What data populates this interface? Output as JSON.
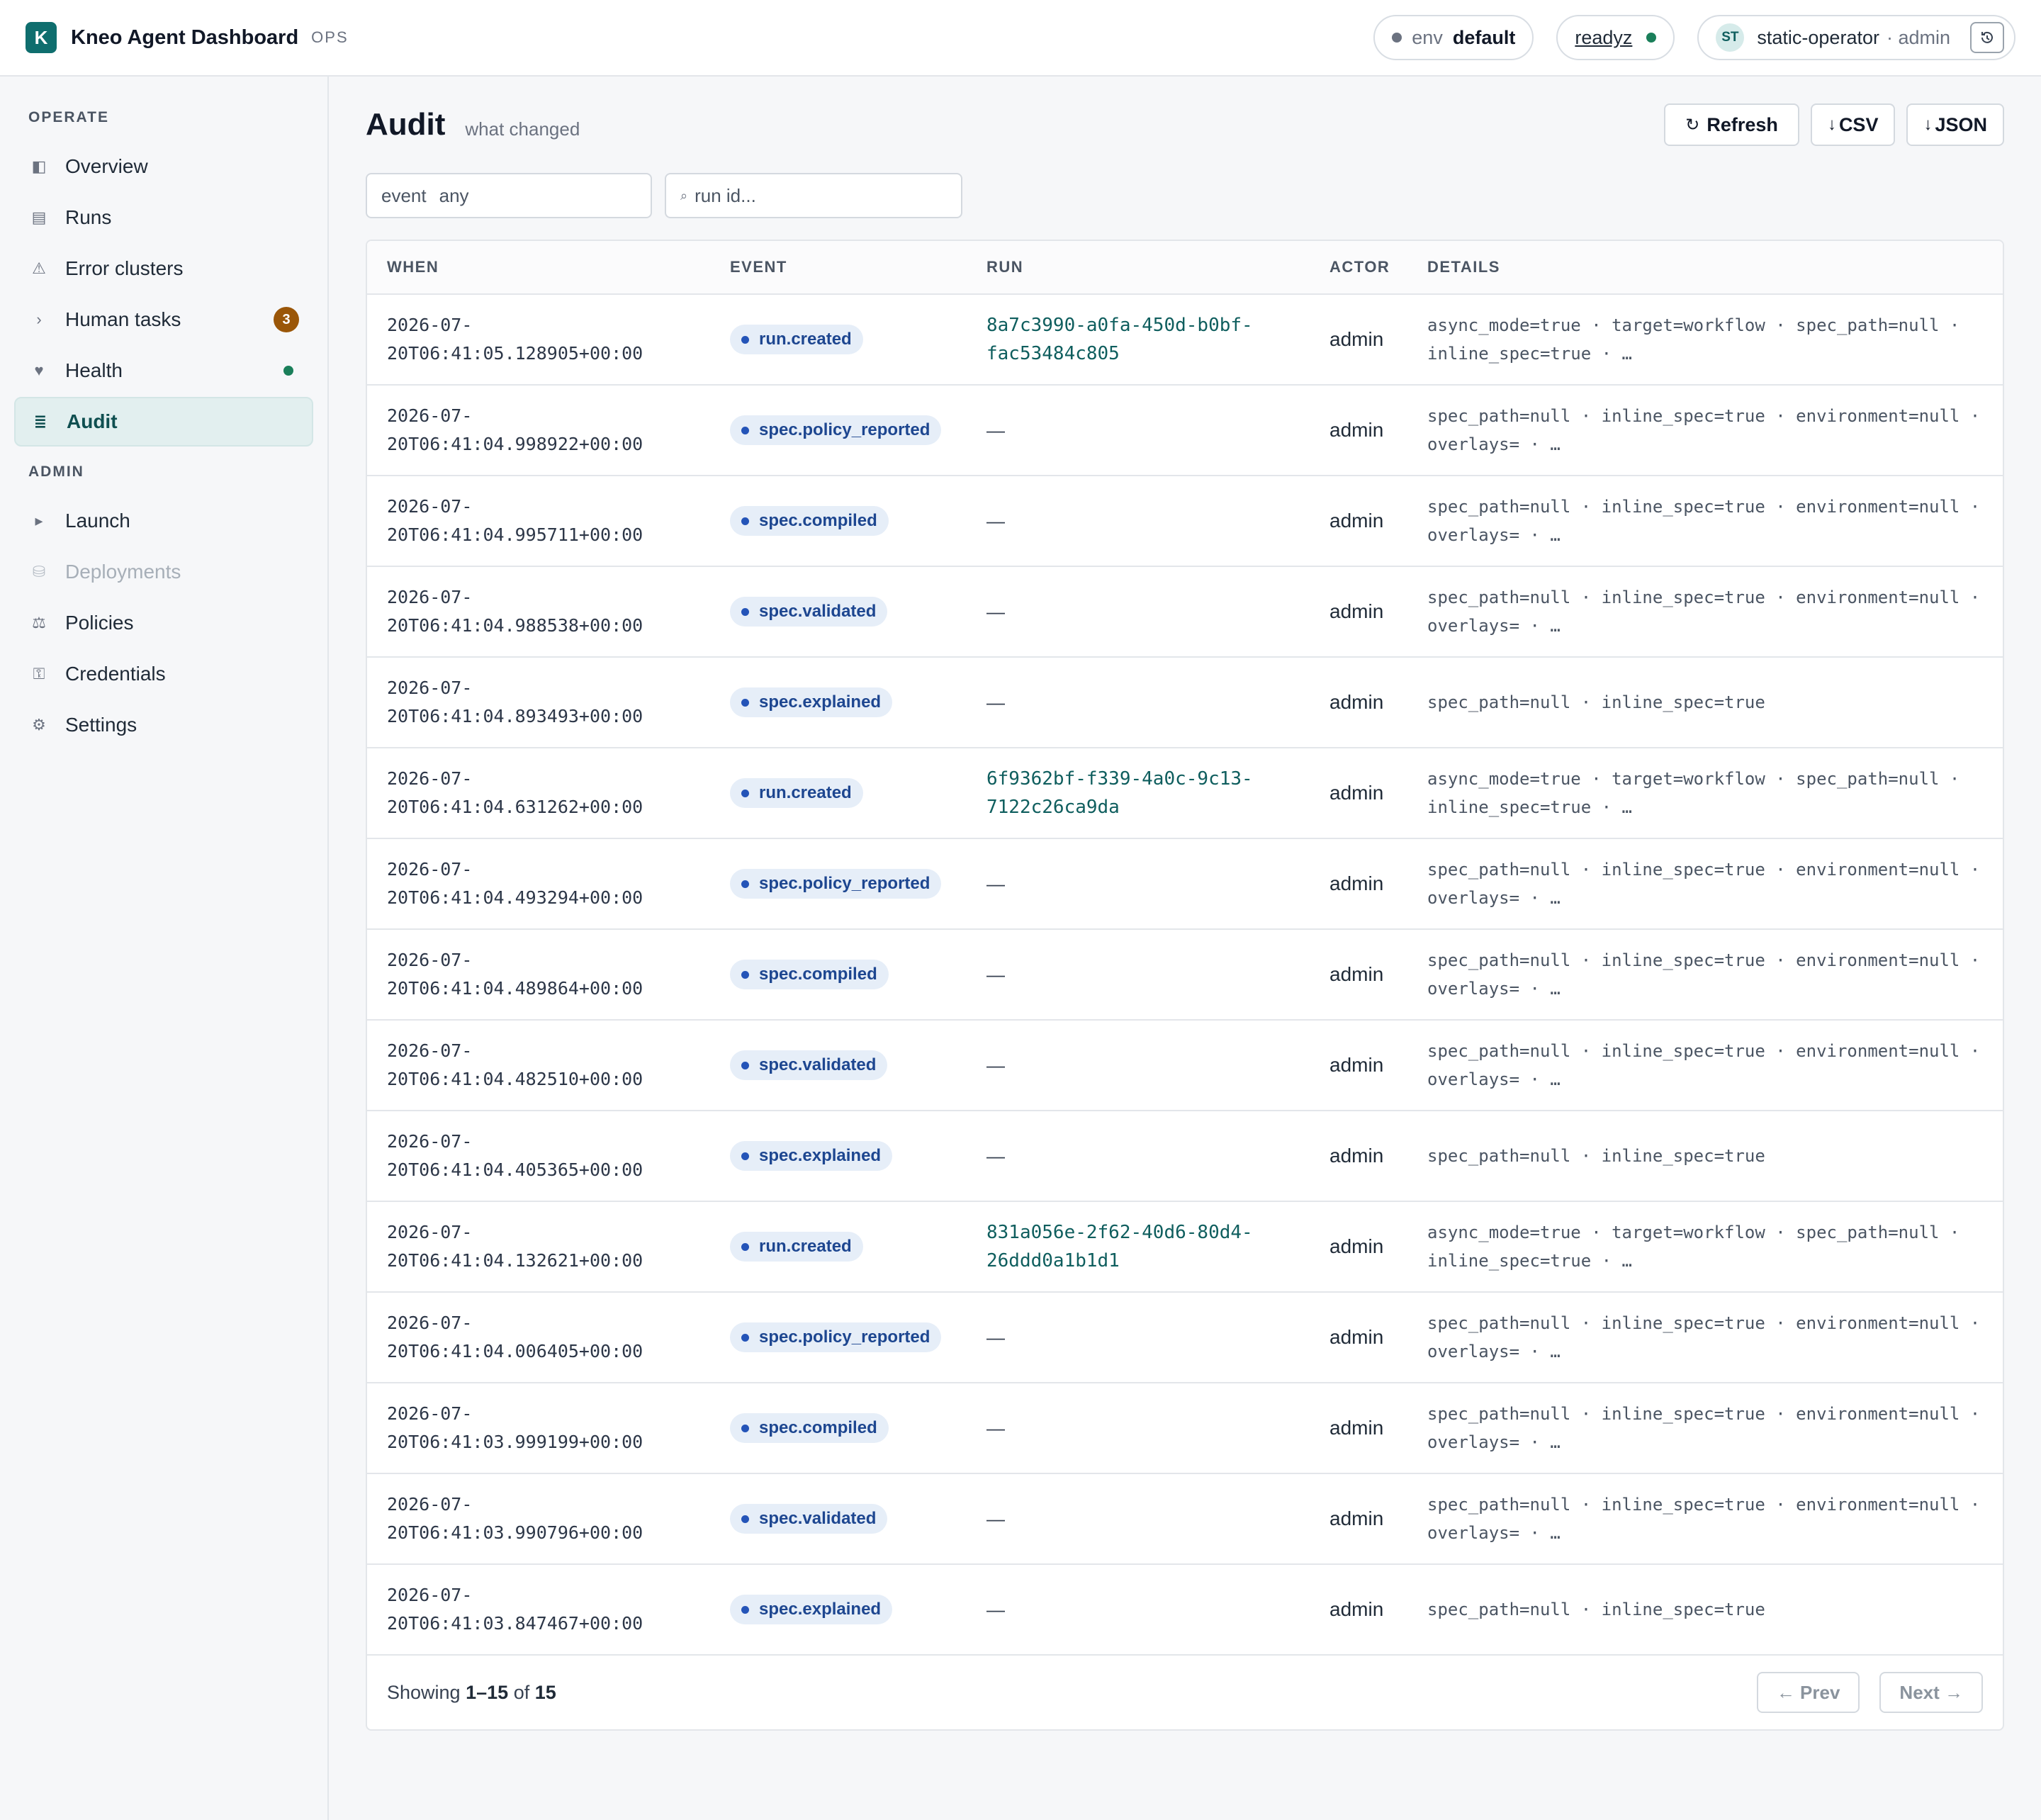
{
  "header": {
    "logo_letter": "K",
    "app_title": "Kneo Agent Dashboard",
    "app_tag": "OPS",
    "env_label": "env",
    "env_value": "default",
    "readyz_label": "readyz",
    "avatar_initials": "ST",
    "user_name": "static-operator",
    "user_role": "· admin"
  },
  "sidebar": {
    "sections": [
      {
        "title": "OPERATE",
        "items": [
          {
            "icon": "◧",
            "icon_name": "overview-icon",
            "label": "Overview"
          },
          {
            "icon": "▤",
            "icon_name": "runs-icon",
            "label": "Runs"
          },
          {
            "icon": "⚠",
            "icon_name": "warning-icon",
            "label": "Error clusters"
          },
          {
            "icon": "›",
            "icon_name": "chevron-right-icon",
            "label": "Human tasks",
            "badge": "3"
          },
          {
            "icon": "♥",
            "icon_name": "heart-icon",
            "label": "Health",
            "status_dot": "green"
          },
          {
            "icon": "≣",
            "icon_name": "audit-icon",
            "label": "Audit",
            "active": true
          }
        ]
      },
      {
        "title": "ADMIN",
        "items": [
          {
            "icon": "▸",
            "icon_name": "play-icon",
            "label": "Launch"
          },
          {
            "icon": "⛁",
            "icon_name": "database-icon",
            "label": "Deployments",
            "disabled": true
          },
          {
            "icon": "⚖",
            "icon_name": "scales-icon",
            "label": "Policies"
          },
          {
            "icon": "⚿",
            "icon_name": "key-icon",
            "label": "Credentials"
          },
          {
            "icon": "⚙",
            "icon_name": "gear-icon",
            "label": "Settings"
          }
        ]
      }
    ]
  },
  "page": {
    "title": "Audit",
    "subtitle": "what changed",
    "actions": {
      "refresh_icon": "↻",
      "refresh_label": "Refresh",
      "csv_icon": "↓",
      "csv_label": "CSV",
      "json_icon": "↓",
      "json_label": "JSON"
    },
    "filters": {
      "event_label": "event",
      "event_value": "any",
      "run_search_icon": "⌕",
      "run_placeholder": "run id..."
    }
  },
  "table": {
    "columns": [
      "WHEN",
      "EVENT",
      "RUN",
      "ACTOR",
      "DETAILS"
    ],
    "rows": [
      {
        "when": "2026-07-\n20T06:41:05.128905+00:00",
        "event": "run.created",
        "run": "8a7c3990-a0fa-450d-b0bf-\nfac53484c805",
        "actor": "admin",
        "details": "async_mode=true · target=workflow · spec_path=null · inline_spec=true · …"
      },
      {
        "when": "2026-07-\n20T06:41:04.998922+00:00",
        "event": "spec.policy_reported",
        "run": "—",
        "actor": "admin",
        "details": "spec_path=null · inline_spec=true · environment=null · overlays= · …"
      },
      {
        "when": "2026-07-\n20T06:41:04.995711+00:00",
        "event": "spec.compiled",
        "run": "—",
        "actor": "admin",
        "details": "spec_path=null · inline_spec=true · environment=null · overlays= · …"
      },
      {
        "when": "2026-07-\n20T06:41:04.988538+00:00",
        "event": "spec.validated",
        "run": "—",
        "actor": "admin",
        "details": "spec_path=null · inline_spec=true · environment=null · overlays= · …"
      },
      {
        "when": "2026-07-\n20T06:41:04.893493+00:00",
        "event": "spec.explained",
        "run": "—",
        "actor": "admin",
        "details": "spec_path=null · inline_spec=true"
      },
      {
        "when": "2026-07-\n20T06:41:04.631262+00:00",
        "event": "run.created",
        "run": "6f9362bf-f339-4a0c-9c13-\n7122c26ca9da",
        "actor": "admin",
        "details": "async_mode=true · target=workflow · spec_path=null · inline_spec=true · …"
      },
      {
        "when": "2026-07-\n20T06:41:04.493294+00:00",
        "event": "spec.policy_reported",
        "run": "—",
        "actor": "admin",
        "details": "spec_path=null · inline_spec=true · environment=null · overlays= · …"
      },
      {
        "when": "2026-07-\n20T06:41:04.489864+00:00",
        "event": "spec.compiled",
        "run": "—",
        "actor": "admin",
        "details": "spec_path=null · inline_spec=true · environment=null · overlays= · …"
      },
      {
        "when": "2026-07-\n20T06:41:04.482510+00:00",
        "event": "spec.validated",
        "run": "—",
        "actor": "admin",
        "details": "spec_path=null · inline_spec=true · environment=null · overlays= · …"
      },
      {
        "when": "2026-07-\n20T06:41:04.405365+00:00",
        "event": "spec.explained",
        "run": "—",
        "actor": "admin",
        "details": "spec_path=null · inline_spec=true"
      },
      {
        "when": "2026-07-\n20T06:41:04.132621+00:00",
        "event": "run.created",
        "run": "831a056e-2f62-40d6-80d4-\n26ddd0a1b1d1",
        "actor": "admin",
        "details": "async_mode=true · target=workflow · spec_path=null · inline_spec=true · …"
      },
      {
        "when": "2026-07-\n20T06:41:04.006405+00:00",
        "event": "spec.policy_reported",
        "run": "—",
        "actor": "admin",
        "details": "spec_path=null · inline_spec=true · environment=null · overlays= · …"
      },
      {
        "when": "2026-07-\n20T06:41:03.999199+00:00",
        "event": "spec.compiled",
        "run": "—",
        "actor": "admin",
        "details": "spec_path=null · inline_spec=true · environment=null · overlays= · …"
      },
      {
        "when": "2026-07-\n20T06:41:03.990796+00:00",
        "event": "spec.validated",
        "run": "—",
        "actor": "admin",
        "details": "spec_path=null · inline_spec=true · environment=null · overlays= · …"
      },
      {
        "when": "2026-07-\n20T06:41:03.847467+00:00",
        "event": "spec.explained",
        "run": "—",
        "actor": "admin",
        "details": "spec_path=null · inline_spec=true"
      }
    ],
    "footer": {
      "showing_label": "Showing",
      "range": "1–15",
      "of_label": "of",
      "total": "15",
      "prev_label": "← Prev",
      "next_label": "Next →"
    }
  },
  "colors": {
    "accent": "#0f6e6e",
    "status_green": "#1a7f5a",
    "badge": "#9a5608",
    "chip_bg": "#e6eef8",
    "chip_text": "#1d4690"
  }
}
